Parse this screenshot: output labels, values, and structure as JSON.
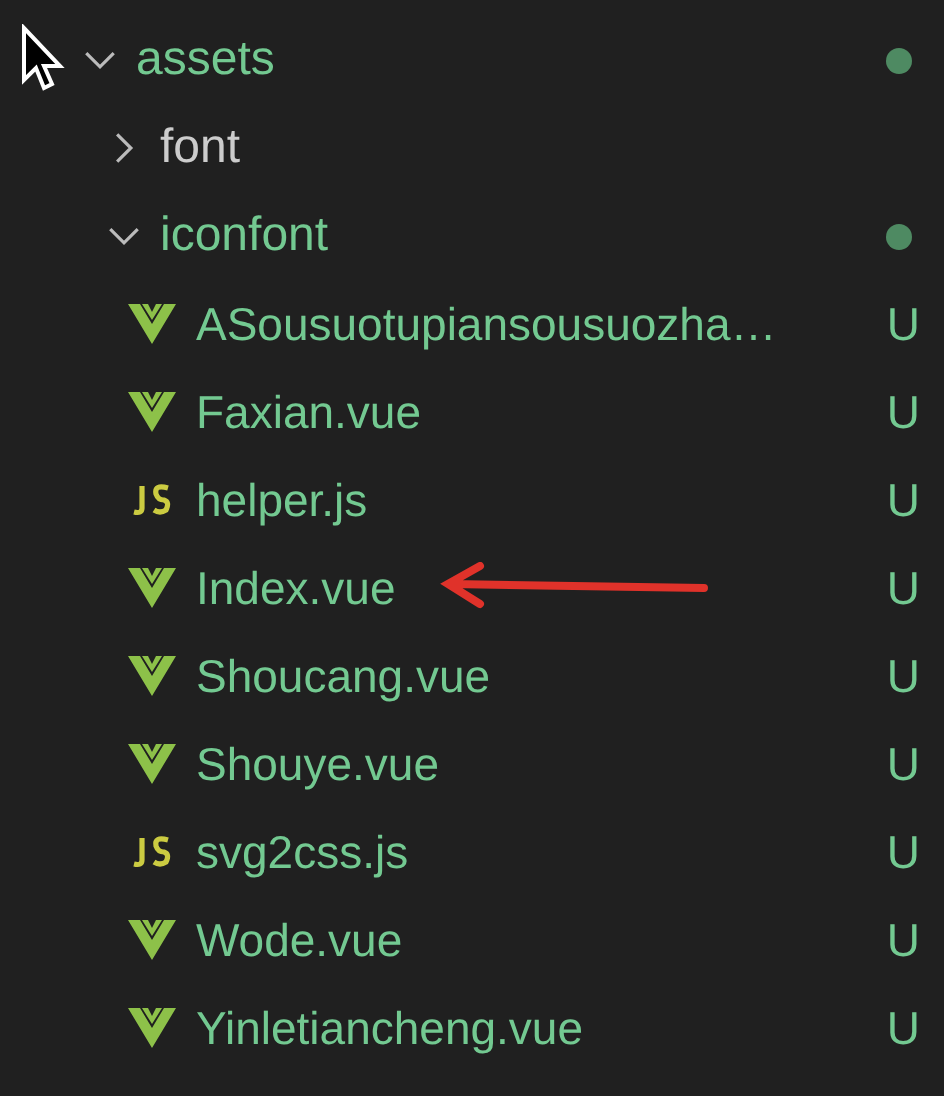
{
  "tree": [
    {
      "name": "assets",
      "kind": "folder",
      "expanded": true,
      "modified": true,
      "children": [
        {
          "name": "font",
          "kind": "folder",
          "expanded": false,
          "modified": false
        },
        {
          "name": "iconfont",
          "kind": "folder",
          "expanded": true,
          "modified": true,
          "children": [
            {
              "name": "ASousuotupiansousuozha…",
              "kind": "vue",
              "status": "U"
            },
            {
              "name": "Faxian.vue",
              "kind": "vue",
              "status": "U"
            },
            {
              "name": "helper.js",
              "kind": "js",
              "status": "U"
            },
            {
              "name": "Index.vue",
              "kind": "vue",
              "status": "U",
              "pointed": true
            },
            {
              "name": "Shoucang.vue",
              "kind": "vue",
              "status": "U"
            },
            {
              "name": "Shouye.vue",
              "kind": "vue",
              "status": "U"
            },
            {
              "name": "svg2css.js",
              "kind": "js",
              "status": "U"
            },
            {
              "name": "Wode.vue",
              "kind": "vue",
              "status": "U"
            },
            {
              "name": "Yinletiancheng.vue",
              "kind": "vue",
              "status": "U"
            }
          ]
        }
      ]
    }
  ]
}
